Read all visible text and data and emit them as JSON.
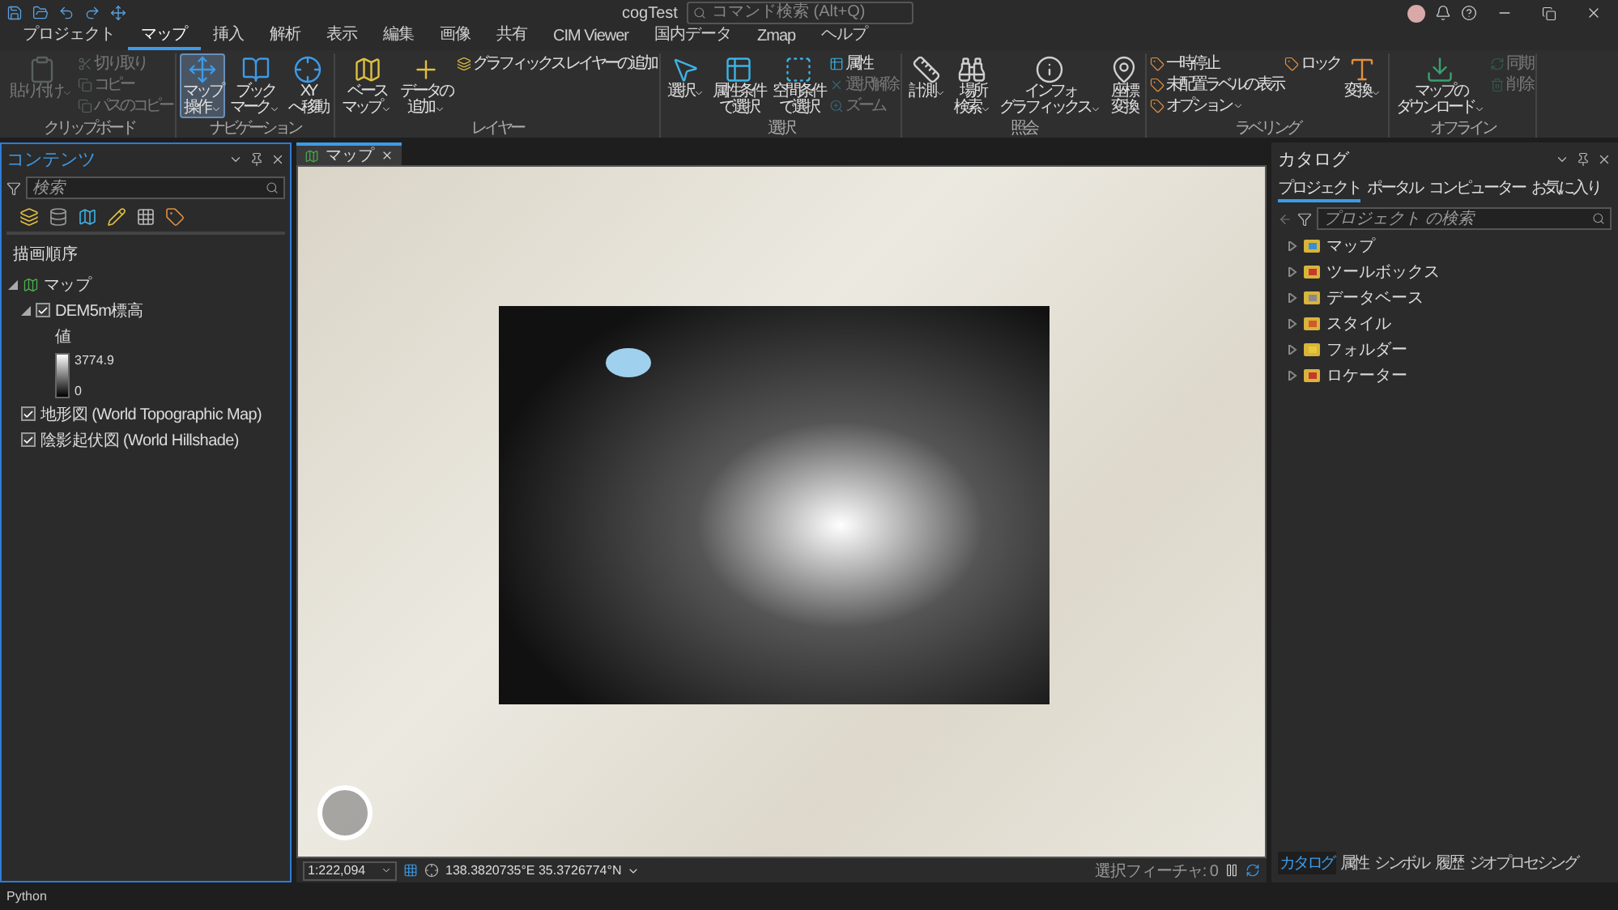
{
  "window": {
    "title": "cogTest",
    "search": {
      "placeholder": "コマンド検索 (Alt+Q)"
    }
  },
  "ribbon_tabs": [
    {
      "label": "プロジェクト",
      "selected": false
    },
    {
      "label": "マップ",
      "selected": true
    },
    {
      "label": "挿入",
      "selected": false
    },
    {
      "label": "解析",
      "selected": false
    },
    {
      "label": "表示",
      "selected": false
    },
    {
      "label": "編集",
      "selected": false
    },
    {
      "label": "画像",
      "selected": false
    },
    {
      "label": "共有",
      "selected": false
    },
    {
      "label": "CIM Viewer",
      "selected": false
    },
    {
      "label": "国内データ",
      "selected": false
    },
    {
      "label": "Zmap",
      "selected": false
    },
    {
      "label": "ヘルプ",
      "selected": false
    }
  ],
  "ribbon_groups": [
    {
      "title": "クリップボード",
      "items": [
        {
          "kind": "large",
          "lines": [
            "貼り付け"
          ],
          "dropdown": true,
          "disabled": true,
          "selected": false
        },
        {
          "kind": "small",
          "label": "切り取り",
          "disabled": true
        },
        {
          "kind": "small",
          "label": "コピー",
          "disabled": true
        },
        {
          "kind": "small",
          "label": "パスのコピー",
          "disabled": true
        }
      ]
    },
    {
      "title": "ナビゲーション",
      "items": [
        {
          "kind": "large",
          "lines": [
            "マップ",
            "操作"
          ],
          "dropdown": true,
          "disabled": false,
          "selected": true
        },
        {
          "kind": "large",
          "lines": [
            "ブック",
            "マーク"
          ],
          "dropdown": true,
          "disabled": false,
          "selected": false
        },
        {
          "kind": "large",
          "lines": [
            "XY",
            "へ移動"
          ],
          "dropdown": false,
          "disabled": false,
          "selected": false
        }
      ]
    },
    {
      "title": "レイヤー",
      "items": [
        {
          "kind": "large",
          "lines": [
            "ベース",
            "マップ"
          ],
          "dropdown": true,
          "disabled": false,
          "selected": false
        },
        {
          "kind": "large",
          "lines": [
            "データの",
            "追加"
          ],
          "dropdown": true,
          "disabled": false,
          "selected": false
        },
        {
          "kind": "small",
          "label": "グラフィックス レイヤーの追加",
          "disabled": false
        }
      ]
    },
    {
      "title": "選択",
      "items": [
        {
          "kind": "large",
          "lines": [
            "選択"
          ],
          "dropdown": true,
          "disabled": false,
          "selected": false
        },
        {
          "kind": "large",
          "lines": [
            "属性条件",
            "で選択"
          ],
          "dropdown": false,
          "disabled": false,
          "selected": false
        },
        {
          "kind": "large",
          "lines": [
            "空間条件",
            "で選択"
          ],
          "dropdown": false,
          "disabled": false,
          "selected": false
        },
        {
          "kind": "small",
          "label": "属性",
          "disabled": false
        },
        {
          "kind": "small",
          "label": "選択解除",
          "disabled": true
        },
        {
          "kind": "small",
          "label": "ズーム",
          "disabled": true
        }
      ]
    },
    {
      "title": "照会",
      "items": [
        {
          "kind": "large",
          "lines": [
            "計測"
          ],
          "dropdown": true,
          "disabled": false,
          "selected": false
        },
        {
          "kind": "large",
          "lines": [
            "場所",
            "検索"
          ],
          "dropdown": true,
          "disabled": false,
          "selected": false
        },
        {
          "kind": "large",
          "lines": [
            "インフォ",
            "グラフィックス"
          ],
          "dropdown": true,
          "disabled": false,
          "selected": false
        },
        {
          "kind": "large",
          "lines": [
            "座標",
            "変換"
          ],
          "dropdown": false,
          "disabled": false,
          "selected": false
        }
      ]
    },
    {
      "title": "ラベリング",
      "items": [
        {
          "kind": "small",
          "label": "一時停止",
          "disabled": false
        },
        {
          "kind": "small",
          "label": "未配置ラベルの表示",
          "disabled": false
        },
        {
          "kind": "small",
          "label": "オプション",
          "dropdown": true,
          "disabled": false
        },
        {
          "kind": "small",
          "label": "ロック",
          "disabled": false
        },
        {
          "kind": "large",
          "lines": [
            "変換"
          ],
          "dropdown": true,
          "disabled": false,
          "selected": false
        }
      ]
    },
    {
      "title": "オフライン",
      "items": [
        {
          "kind": "large",
          "lines": [
            "マップの",
            "ダウンロード"
          ],
          "dropdown": true,
          "disabled": false,
          "selected": false
        },
        {
          "kind": "small",
          "label": "同期",
          "disabled": true
        },
        {
          "kind": "small",
          "label": "削除",
          "disabled": true
        }
      ]
    }
  ],
  "contents": {
    "title": "コンテンツ",
    "search": {
      "placeholder": "検索"
    },
    "heading": "描画順序",
    "tree": [
      {
        "label": "マップ",
        "expanded": true,
        "children": [
          {
            "label": "DEM5m標高",
            "checked": true,
            "expanded": true,
            "legend": {
              "title": "値",
              "high": "3774.9",
              "low": "0"
            }
          },
          {
            "label": "地形図 (World Topographic Map)",
            "checked": true
          },
          {
            "label": "陰影起伏図 (World Hillshade)",
            "checked": true
          }
        ]
      }
    ]
  },
  "map": {
    "tab": "マップ",
    "scale": "1:222,094",
    "coordinates": "138.3820735°E 35.3726774°N",
    "selected_features": "選択フィーチャ: 0"
  },
  "catalog": {
    "title": "カタログ",
    "tabs": [
      {
        "label": "プロジェクト",
        "selected": true
      },
      {
        "label": "ポータル",
        "selected": false
      },
      {
        "label": "コンピューター",
        "selected": false
      },
      {
        "label": "お気に入り",
        "selected": false
      }
    ],
    "search": {
      "placeholder": "プロジェクト の検索"
    },
    "items": [
      {
        "label": "マップ",
        "color": "#3b8fd0"
      },
      {
        "label": "ツールボックス",
        "color": "#c8382c"
      },
      {
        "label": "データベース",
        "color": "#8a8a8a"
      },
      {
        "label": "スタイル",
        "color": "#d05a2a"
      },
      {
        "label": "フォルダー",
        "color": "#e8c93a"
      },
      {
        "label": "ロケーター",
        "color": "#c8382c"
      }
    ]
  },
  "bottom_tabs": [
    {
      "label": "カタログ",
      "selected": true
    },
    {
      "label": "属性",
      "selected": false
    },
    {
      "label": "シンボル",
      "selected": false
    },
    {
      "label": "履歴",
      "selected": false
    },
    {
      "label": "ジオプロセシング",
      "selected": false
    }
  ],
  "status_bar": {
    "text": "Python"
  }
}
